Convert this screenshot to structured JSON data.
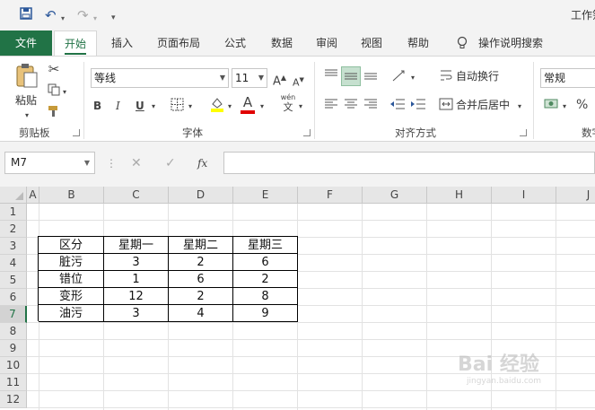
{
  "title_bar": {
    "title": "工作簿",
    "quick_access": [
      "save-icon",
      "undo-icon",
      "redo-icon",
      "customize-icon"
    ]
  },
  "tabs": [
    {
      "id": "file",
      "label": "文件"
    },
    {
      "id": "home",
      "label": "开始"
    },
    {
      "id": "insert",
      "label": "插入"
    },
    {
      "id": "layout",
      "label": "页面布局"
    },
    {
      "id": "formula",
      "label": "公式"
    },
    {
      "id": "data",
      "label": "数据"
    },
    {
      "id": "review",
      "label": "审阅"
    },
    {
      "id": "view",
      "label": "视图"
    },
    {
      "id": "help",
      "label": "帮助"
    },
    {
      "id": "tellme",
      "label": "操作说明搜索"
    }
  ],
  "ribbon": {
    "clipboard": {
      "paste_label": "粘贴",
      "group_label": "剪贴板"
    },
    "font": {
      "font_name": "等线",
      "font_size": "11",
      "group_label": "字体",
      "bold": "B",
      "italic": "I",
      "underline": "U",
      "grow": "A",
      "shrink": "A",
      "color_letter": "A",
      "fill_color": "#ffff00",
      "font_color": "#e00000",
      "phonetic_top": "wén",
      "phonetic_bottom": "文"
    },
    "alignment": {
      "wrap_label": "自动换行",
      "merge_label": "合并后居中",
      "group_label": "对齐方式"
    },
    "number": {
      "format": "常规",
      "percent": "%",
      "group_label": "数字"
    }
  },
  "formula_bar": {
    "name_box": "M7",
    "fx_label": "fx",
    "formula": ""
  },
  "grid": {
    "columns": [
      "A",
      "B",
      "C",
      "D",
      "E",
      "F",
      "G",
      "H",
      "I",
      "J"
    ],
    "rows": [
      "1",
      "2",
      "3",
      "4",
      "5",
      "6",
      "7",
      "8",
      "9",
      "10",
      "11",
      "12"
    ],
    "selected_row": "7",
    "table": {
      "header": [
        "区分",
        "星期一",
        "星期二",
        "星期三"
      ],
      "rows": [
        [
          "脏污",
          "3",
          "2",
          "6"
        ],
        [
          "错位",
          "1",
          "6",
          "2"
        ],
        [
          "变形",
          "12",
          "2",
          "8"
        ],
        [
          "油污",
          "3",
          "4",
          "9"
        ]
      ]
    }
  },
  "watermark": {
    "main": "Bai 经验",
    "sub": "jingyan.baidu.com"
  },
  "colors": {
    "accent": "#217346",
    "ribbon_bg": "#f3f3f3"
  }
}
